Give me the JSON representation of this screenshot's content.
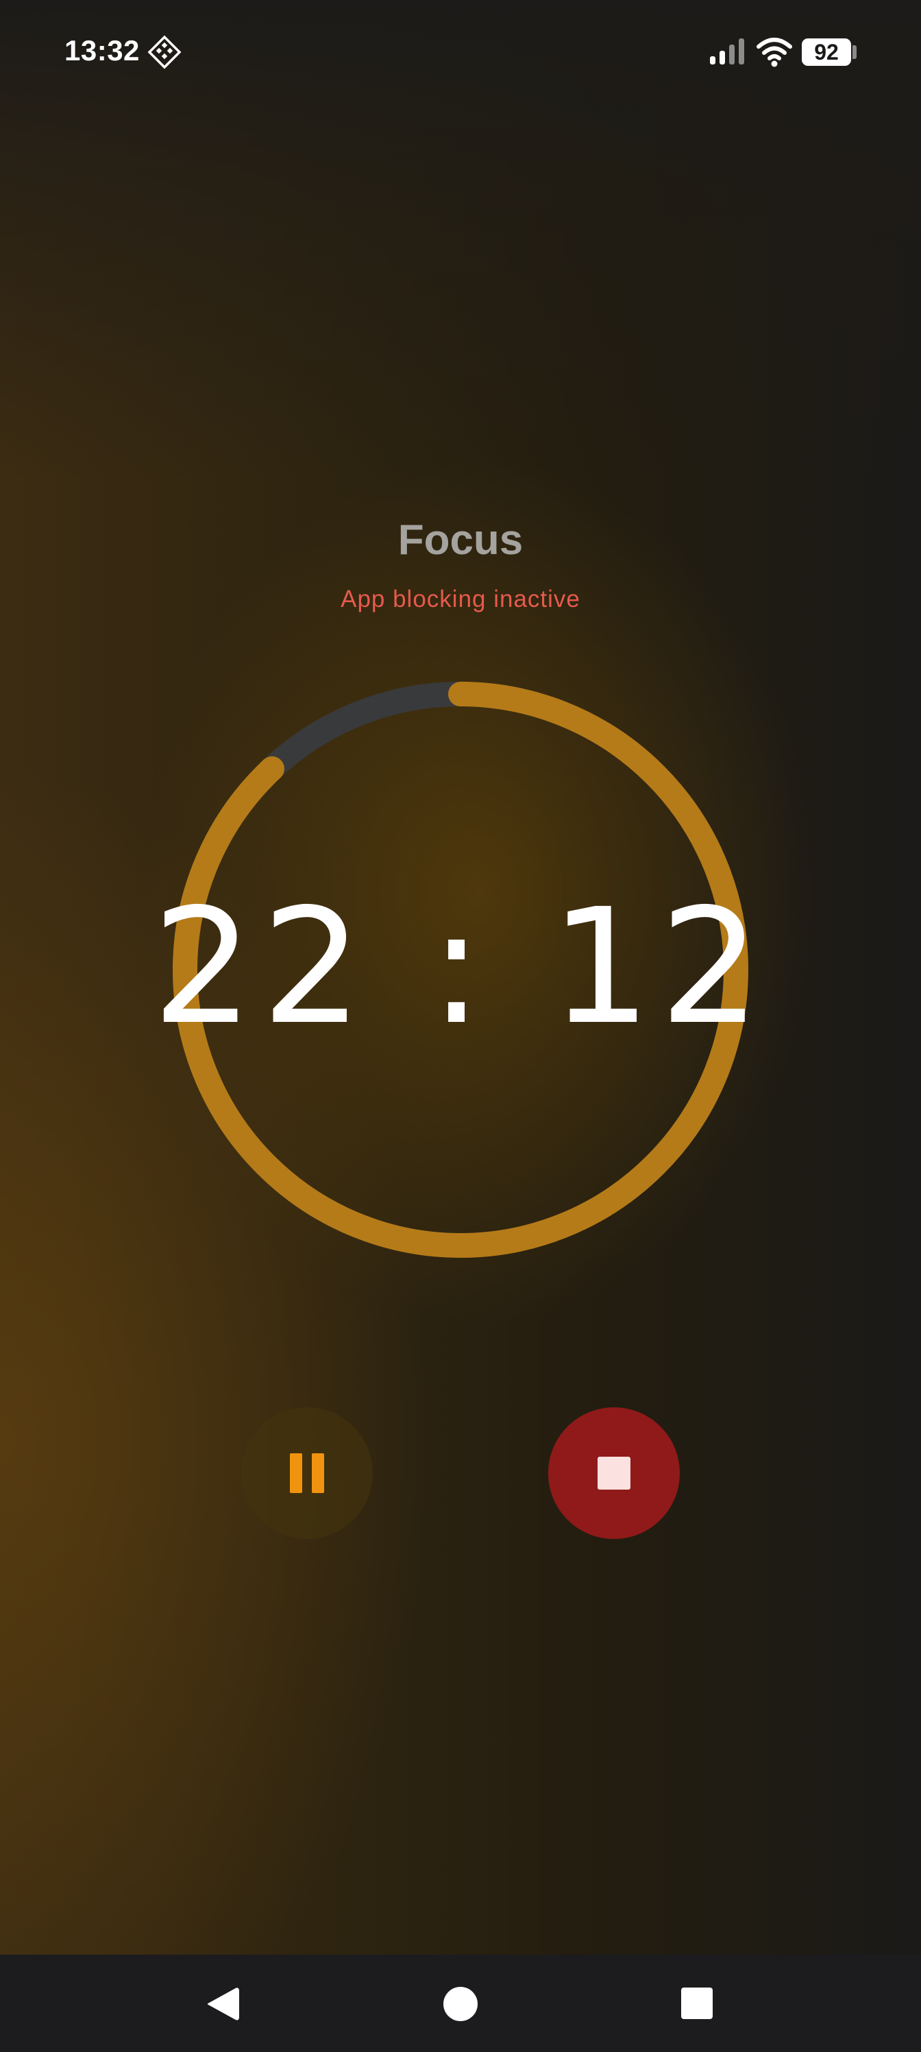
{
  "status_bar": {
    "time": "13:32",
    "app_icon": "diamond-grid-icon",
    "signal_icon": "cellular-signal-icon",
    "wifi_icon": "wifi-icon",
    "battery_level": "92"
  },
  "session": {
    "title": "Focus",
    "blocking_status": "App blocking inactive"
  },
  "timer": {
    "remaining": "22 : 12",
    "progress_fraction": 0.88,
    "ring_color": "#b57b18",
    "track_color": "#393a3c"
  },
  "controls": {
    "pause_icon": "pause-icon",
    "stop_icon": "stop-icon",
    "pause_color": "#f0930f",
    "stop_color": "#8f1a19"
  },
  "nav": {
    "back_icon": "back-triangle-icon",
    "home_icon": "home-circle-icon",
    "recents_icon": "recents-square-icon"
  }
}
